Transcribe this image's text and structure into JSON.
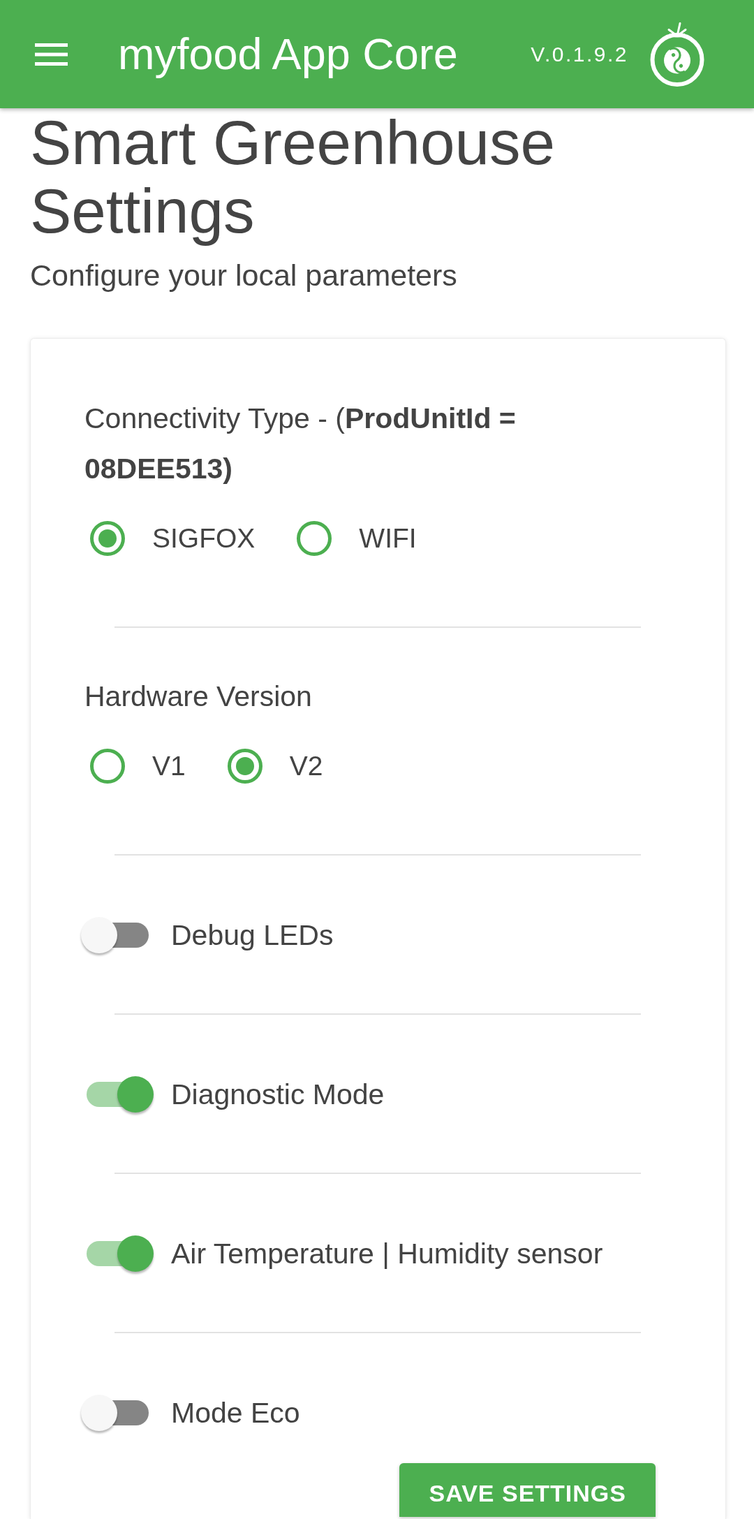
{
  "app_bar": {
    "title": "myfood App Core",
    "version": "V.0.1.9.2"
  },
  "page": {
    "title": "Smart Greenhouse Settings",
    "subtitle": "Configure your local parameters"
  },
  "settings": {
    "radio_groups": [
      {
        "label": "Connectivity Type - (**ProdUnitId = 08DEE513)**",
        "options": [
          {
            "label": "SIGFOX",
            "selected": true
          },
          {
            "label": "WIFI",
            "selected": false
          }
        ]
      },
      {
        "label": "Hardware Version",
        "options": [
          {
            "label": "V1",
            "selected": false
          },
          {
            "label": "V2",
            "selected": true
          }
        ]
      }
    ],
    "toggles": [
      {
        "label": "Debug LEDs",
        "on": false
      },
      {
        "label": "Diagnostic Mode",
        "on": true
      },
      {
        "label": "Air Temperature | Humidity sensor",
        "on": true
      },
      {
        "label": "Mode Eco",
        "on": false
      }
    ],
    "save_button": "SAVE SETTINGS"
  }
}
